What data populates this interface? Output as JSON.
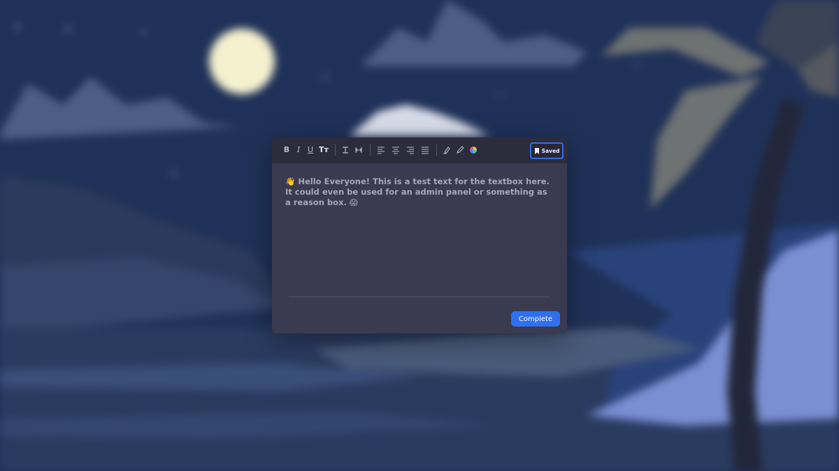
{
  "toolbar": {
    "bold": "B",
    "italic": "I",
    "underline": "U",
    "text_size": "Tт",
    "saved_label": "Saved"
  },
  "editor": {
    "content": "👋 Hello Everyone! This is a test text for the textbox here. It could even be used for an admin panel or something as a reason box. 😱",
    "complete_label": "Complete"
  },
  "colors": {
    "accent": "#2f6ff0",
    "panel": "#3a3a50",
    "toolbar": "#2c2c3d"
  }
}
